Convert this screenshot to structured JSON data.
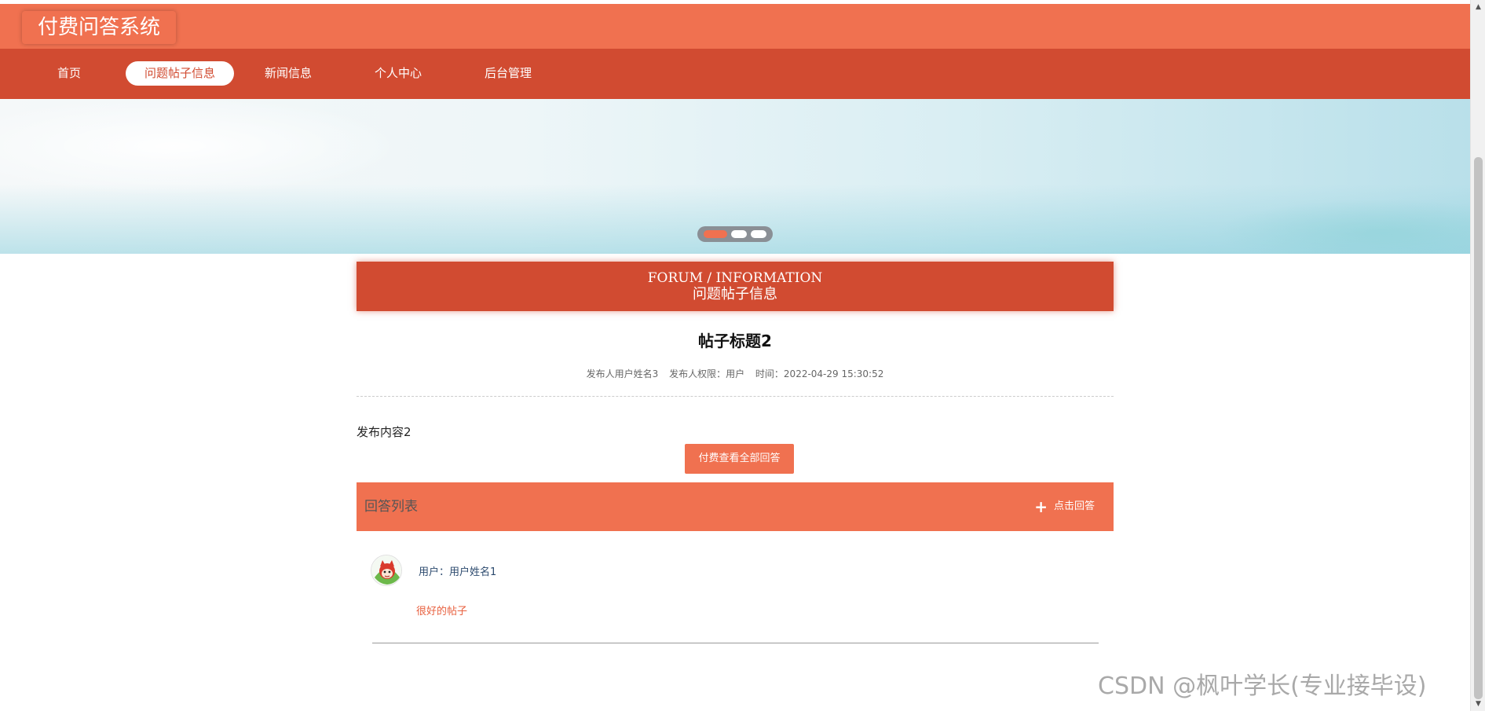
{
  "app": {
    "title": "付费问答系统"
  },
  "nav": {
    "items": [
      {
        "label": "首页"
      },
      {
        "label": "问题帖子信息",
        "active": true
      },
      {
        "label": "新闻信息"
      },
      {
        "label": "个人中心"
      },
      {
        "label": "后台管理"
      }
    ]
  },
  "banner": {
    "slides_count": 3,
    "active_slide": 1
  },
  "section": {
    "title_en": "FORUM / INFORMATION",
    "title_cn": "问题帖子信息"
  },
  "post": {
    "title": "帖子标题2",
    "author": "发布人用户姓名3",
    "role": "发布人权限：用户",
    "time": "时间：2022-04-29 15:30:52",
    "content": "发布内容2",
    "pay_button": "付费查看全部回答"
  },
  "answers": {
    "title": "回答列表",
    "reply_button": "点击回答",
    "items": [
      {
        "user": "用户：用户姓名1",
        "text": "很好的帖子"
      }
    ]
  },
  "watermark": "CSDN @枫叶学长(专业接毕设)",
  "colors": {
    "primary": "#f07150",
    "primary_dark": "#d14b31",
    "accent_text": "#e8603f",
    "user_text": "#2c4a6e"
  },
  "icons": {
    "plus": "plus-icon",
    "avatar": "avatar-image",
    "scroll_up": "scroll-up-icon",
    "scroll_down": "scroll-down-icon"
  }
}
